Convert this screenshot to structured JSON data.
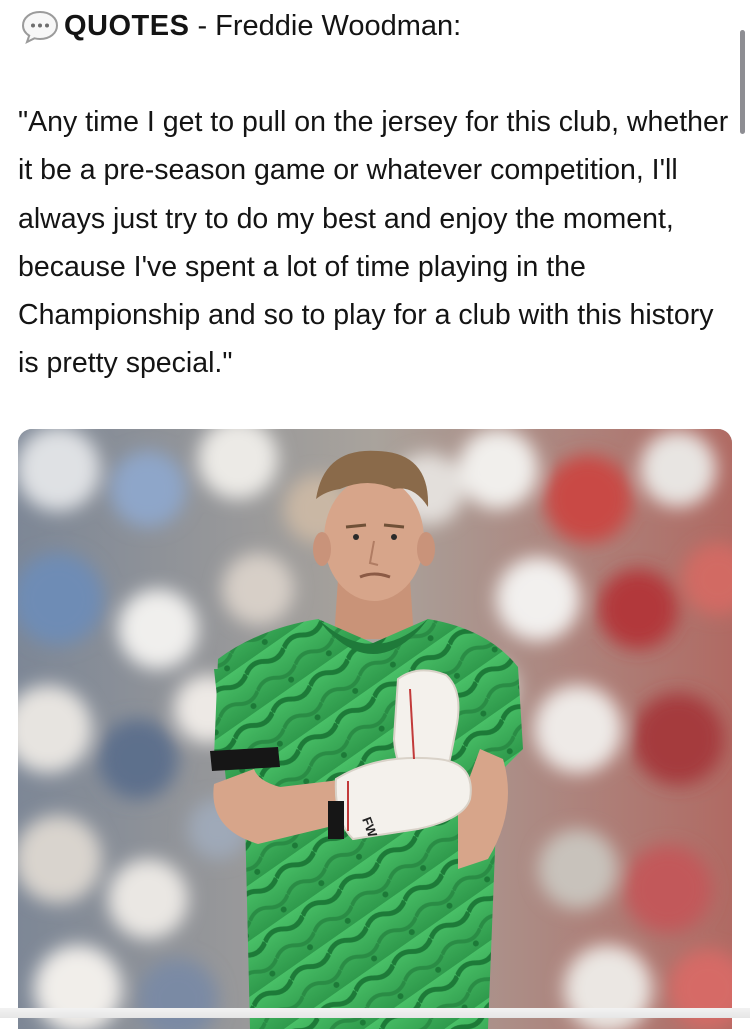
{
  "header": {
    "icon": "speech-bubble-icon",
    "label": "QUOTES",
    "separator": "-",
    "name": "Freddie Woodman:"
  },
  "quote": {
    "text": "\"Any time I get to pull on the jersey for this club, whether it be a pre-season game or whatever competition, I'll always just try to do my best and enjoy the moment, because I've spent a lot of time playing in the Championship and so to play for a club with this history is pretty special.\""
  },
  "photo": {
    "glove_text": "FW",
    "colors": {
      "jersey": "#3fb35a",
      "jersey_dark": "#1f7a3a",
      "glove": "#f4f1ec",
      "skin": "#d7a58a",
      "hair": "#8a6a4a"
    }
  }
}
